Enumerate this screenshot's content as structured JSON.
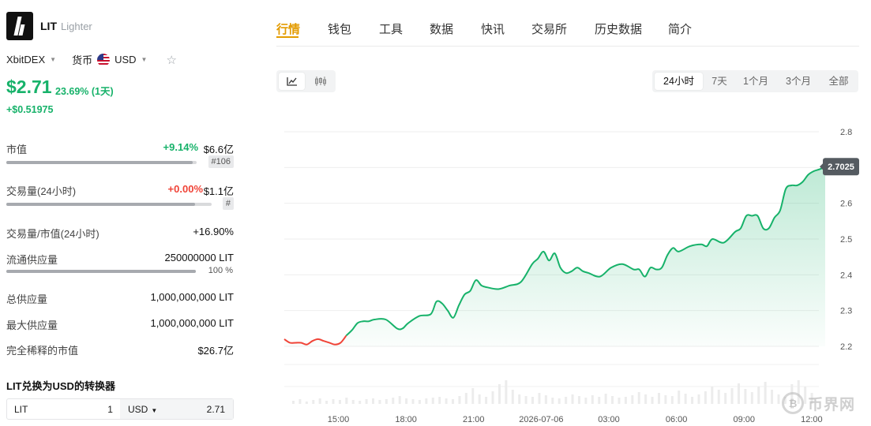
{
  "token": {
    "symbol": "LIT",
    "name": "Lighter"
  },
  "selectors": {
    "exchange": "XbitDEX",
    "currency_label": "货币",
    "currency": "USD"
  },
  "price": {
    "value": "$2.71",
    "change_pct": "23.69% (1天)",
    "change_abs": "+$0.51975"
  },
  "stats": {
    "market_cap": {
      "label": "市值",
      "change": "+9.14%",
      "value": "$6.6亿",
      "rank": "#106",
      "bar": 0.98
    },
    "volume": {
      "label": "交易量(24小时)",
      "change": "+0.00%",
      "value": "$1.1亿",
      "rank": "#",
      "bar": 0.92
    },
    "vol_mcap": {
      "label": "交易量/市值(24小时)",
      "value": "+16.90%"
    },
    "circulating": {
      "label": "流通供应量",
      "value": "250000000 LIT",
      "pct": "100 %",
      "bar": 1.0
    },
    "total": {
      "label": "总供应量",
      "value": "1,000,000,000 LIT"
    },
    "max": {
      "label": "最大供应量",
      "value": "1,000,000,000 LIT"
    },
    "fdv": {
      "label": "完全稀释的市值",
      "value": "$26.7亿"
    }
  },
  "converter": {
    "title": "LIT兑换为USD的转换器",
    "from": "LIT",
    "from_value": "1",
    "to": "USD",
    "to_value": "2.71"
  },
  "tabs": [
    "行情",
    "钱包",
    "工具",
    "数据",
    "快讯",
    "交易所",
    "历史数据",
    "简介"
  ],
  "active_tab": "行情",
  "chart_types": [
    "line-chart-icon",
    "candlestick-icon"
  ],
  "ranges": [
    "24小时",
    "7天",
    "1个月",
    "3个月",
    "全部"
  ],
  "active_range": "24小时",
  "watermark": {
    "text": "币界网"
  },
  "colors": {
    "up": "#17b26a",
    "down": "#f04438",
    "accent": "#e39b00"
  },
  "chart_data": {
    "type": "line",
    "x_ticks": [
      "15:00",
      "18:00",
      "21:00",
      "2026-07-06",
      "03:00",
      "06:00",
      "09:00",
      "12:00"
    ],
    "x_tick_hours": [
      2.4,
      5.4,
      8.4,
      11.4,
      14.4,
      17.4,
      20.4,
      23.4
    ],
    "y_ticks": [
      2.2,
      2.3,
      2.4,
      2.5,
      2.6,
      2.7,
      2.8
    ],
    "ylim": [
      2.2,
      2.8
    ],
    "last_price_label": "2.7025",
    "down_segment_end_hour": 2.6,
    "x_hours": [
      0,
      0.25,
      0.5,
      0.75,
      1.0,
      1.25,
      1.5,
      1.75,
      2.0,
      2.25,
      2.5,
      2.75,
      3.0,
      3.25,
      3.5,
      3.75,
      4.0,
      4.5,
      5.0,
      5.25,
      5.5,
      6.0,
      6.5,
      6.75,
      7.0,
      7.25,
      7.5,
      7.75,
      8.0,
      8.25,
      8.5,
      8.75,
      9.0,
      9.5,
      10.0,
      10.5,
      11.0,
      11.25,
      11.5,
      11.75,
      12.0,
      12.25,
      12.5,
      12.75,
      13.0,
      13.25,
      13.5,
      14.0,
      14.5,
      15.0,
      15.5,
      15.75,
      16.0,
      16.25,
      16.5,
      16.75,
      17.0,
      17.25,
      17.5,
      18.0,
      18.5,
      18.75,
      19.0,
      19.5,
      20.0,
      20.25,
      20.5,
      20.75,
      21.0,
      21.25,
      21.5,
      21.75,
      22.0,
      22.25,
      22.5,
      22.75,
      23.0,
      23.25,
      23.5,
      23.75,
      24.0
    ],
    "values": [
      2.22,
      2.21,
      2.21,
      2.21,
      2.205,
      2.215,
      2.22,
      2.215,
      2.21,
      2.205,
      2.21,
      2.23,
      2.245,
      2.265,
      2.27,
      2.27,
      2.275,
      2.275,
      2.25,
      2.25,
      2.265,
      2.285,
      2.29,
      2.325,
      2.32,
      2.3,
      2.28,
      2.315,
      2.345,
      2.355,
      2.385,
      2.37,
      2.365,
      2.36,
      2.37,
      2.38,
      2.43,
      2.445,
      2.465,
      2.44,
      2.46,
      2.42,
      2.405,
      2.41,
      2.42,
      2.41,
      2.405,
      2.395,
      2.42,
      2.43,
      2.415,
      2.415,
      2.395,
      2.42,
      2.415,
      2.42,
      2.455,
      2.475,
      2.465,
      2.48,
      2.485,
      2.48,
      2.5,
      2.49,
      2.52,
      2.53,
      2.565,
      2.565,
      2.565,
      2.53,
      2.53,
      2.56,
      2.58,
      2.64,
      2.65,
      2.65,
      2.66,
      2.68,
      2.69,
      2.695,
      2.7025
    ],
    "volume_hint": "faint volume bars along the bottom",
    "grid": true
  }
}
